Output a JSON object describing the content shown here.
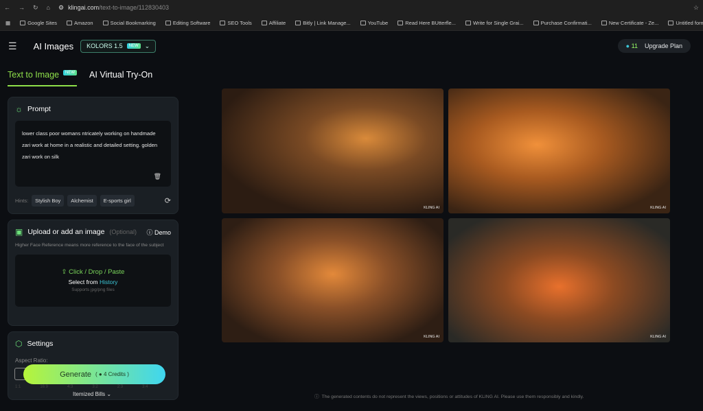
{
  "browser": {
    "url_host": "klingai.com",
    "url_path": "/text-to-image/112830403",
    "bookmarks": [
      "Google Sites",
      "Amazon",
      "Social Bookmarking",
      "Editing Software",
      "SEO Tools",
      "Affiliate",
      "Bitly | Link Manage...",
      "YouTube",
      "Read Here BUtterfle...",
      "Write for Single Grai...",
      "Purchase Confirmati...",
      "New Certificate - Ze...",
      "Untitled form - Goo..."
    ]
  },
  "header": {
    "title": "AI Images",
    "model": "KOLORS 1.5",
    "new_badge": "NEW",
    "credits": "11",
    "upgrade": "Upgrade Plan"
  },
  "tabs": [
    {
      "label": "Text to Image",
      "badge": "NEW",
      "active": true
    },
    {
      "label": "AI Virtual Try-On"
    }
  ],
  "prompt": {
    "title": "Prompt",
    "text": "lower class poor womans ntricately working on handmade zari work at home in a realistic and detailed setting. golden  zari work on silk",
    "hints_label": "Hints:",
    "hints": [
      "Stylish Boy",
      "Alchemist",
      "E-sports girl"
    ]
  },
  "upload": {
    "title": "Upload or add an image",
    "optional": "(Optional)",
    "demo": "Demo",
    "desc": "Higher Face Reference means more reference to the face of the subject",
    "click": "Click / Drop / Paste",
    "select": "Select from",
    "history": "History",
    "supports": "Supports jpg/png files"
  },
  "settings": {
    "title": "Settings",
    "aspect_label": "Aspect Ratio:",
    "ratios": [
      "1:1",
      "16:9",
      "4:3",
      "3:2",
      "2:3",
      "3:4"
    ]
  },
  "generate": {
    "label": "Generate",
    "credits": "4 Credits"
  },
  "bills": "Itemized Bills",
  "images": [
    {
      "watermark": "KLING AI"
    },
    {
      "watermark": "KLING AI"
    },
    {
      "watermark": "KLING AI"
    },
    {
      "watermark": "KLING AI"
    }
  ],
  "disclaimer": "The generated contents do not represent the views, positions or attitudes of KLING AI. Please use them responsibly and kindly.",
  "colors": {
    "accent_green": "#8fe04a",
    "accent_cyan": "#3cc7d8",
    "background": "#0c0e12"
  }
}
